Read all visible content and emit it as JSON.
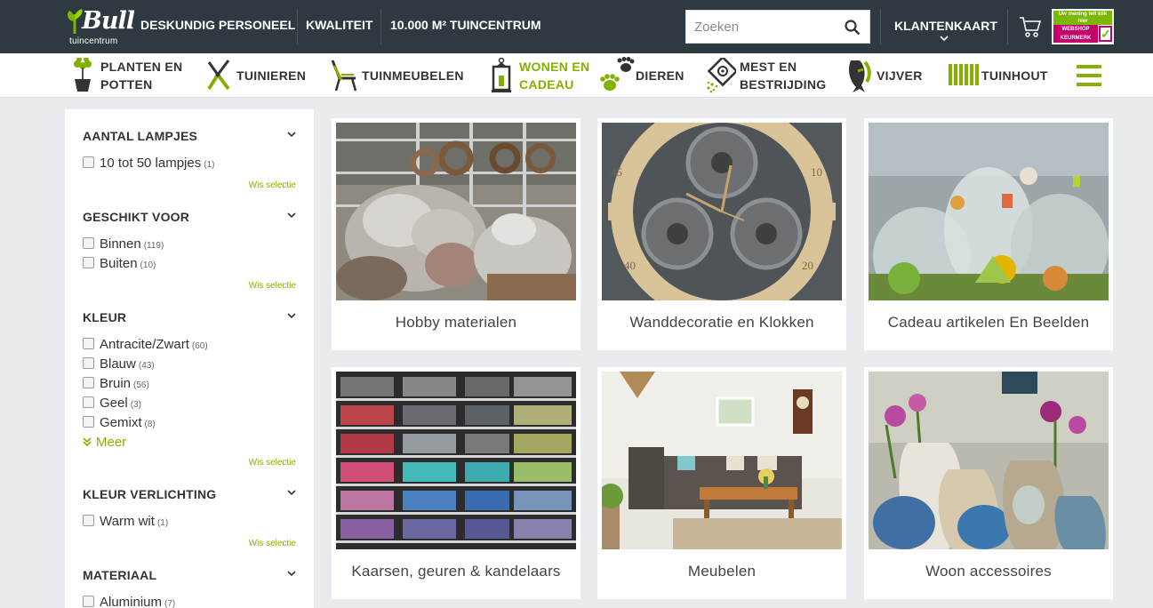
{
  "header": {
    "logo_word": "Bull",
    "logo_sub": "tuincentrum",
    "usps": [
      "DESKUNDIG PERSONEEL",
      "KWALITEIT",
      "10.000 M² TUINCENTRUM"
    ],
    "search_placeholder": "Zoeken",
    "klantenkaart": "KLANTENKAART",
    "keurmerk_top": "Uw mening telt klik hier",
    "keurmerk_bottom": "WEBSHOP KEURMERK"
  },
  "categories": [
    {
      "line1": "PLANTEN EN",
      "line2": "POTTEN",
      "icon": "plant-pot-icon"
    },
    {
      "line1": "TUINIEREN",
      "line2": "",
      "icon": "pruning-shears-icon"
    },
    {
      "line1": "TUINMEUBELEN",
      "line2": "",
      "icon": "garden-chair-icon"
    },
    {
      "line1": "WONEN EN",
      "line2": "CADEAU",
      "icon": "lantern-icon"
    },
    {
      "line1": "DIEREN",
      "line2": "",
      "icon": "paw-icon"
    },
    {
      "line1": "MEST EN",
      "line2": "BESTRIJDING",
      "icon": "spray-icon"
    },
    {
      "line1": "VIJVER",
      "line2": "",
      "icon": "koi-fish-icon"
    },
    {
      "line1": "TUINHOUT",
      "line2": "",
      "icon": "wood-fence-icon"
    }
  ],
  "filters": [
    {
      "title": "AANTAL LAMPJES",
      "options": [
        {
          "label": "10 tot 50 lampjes",
          "count": "(1)"
        }
      ],
      "clear": "Wis selectie"
    },
    {
      "title": "GESCHIKT VOOR",
      "options": [
        {
          "label": "Binnen",
          "count": "(119)"
        },
        {
          "label": "Buiten",
          "count": "(10)"
        }
      ],
      "clear": "Wis selectie"
    },
    {
      "title": "KLEUR",
      "options": [
        {
          "label": "Antracite/Zwart",
          "count": "(60)"
        },
        {
          "label": "Blauw",
          "count": "(43)"
        },
        {
          "label": "Bruin",
          "count": "(56)"
        },
        {
          "label": "Geel",
          "count": "(3)"
        },
        {
          "label": "Gemixt",
          "count": "(8)"
        }
      ],
      "more": "Meer",
      "clear": "Wis selectie"
    },
    {
      "title": "KLEUR VERLICHTING",
      "options": [
        {
          "label": "Warm wit",
          "count": "(1)"
        }
      ],
      "clear": "Wis selectie"
    },
    {
      "title": "MATERIAAL",
      "options": [
        {
          "label": "Aluminium",
          "count": "(7)"
        }
      ]
    }
  ],
  "products": [
    {
      "title": "Hobby materialen"
    },
    {
      "title": "Wanddecoratie en Klokken"
    },
    {
      "title": "Cadeau artikelen En Beelden"
    },
    {
      "title": "Kaarsen, geuren & kandelaars"
    },
    {
      "title": "Meubelen"
    },
    {
      "title": "Woon accessoires"
    }
  ],
  "colors": {
    "accent": "#84b100",
    "topbar": "#2f3a40",
    "background": "#e9ebee"
  }
}
